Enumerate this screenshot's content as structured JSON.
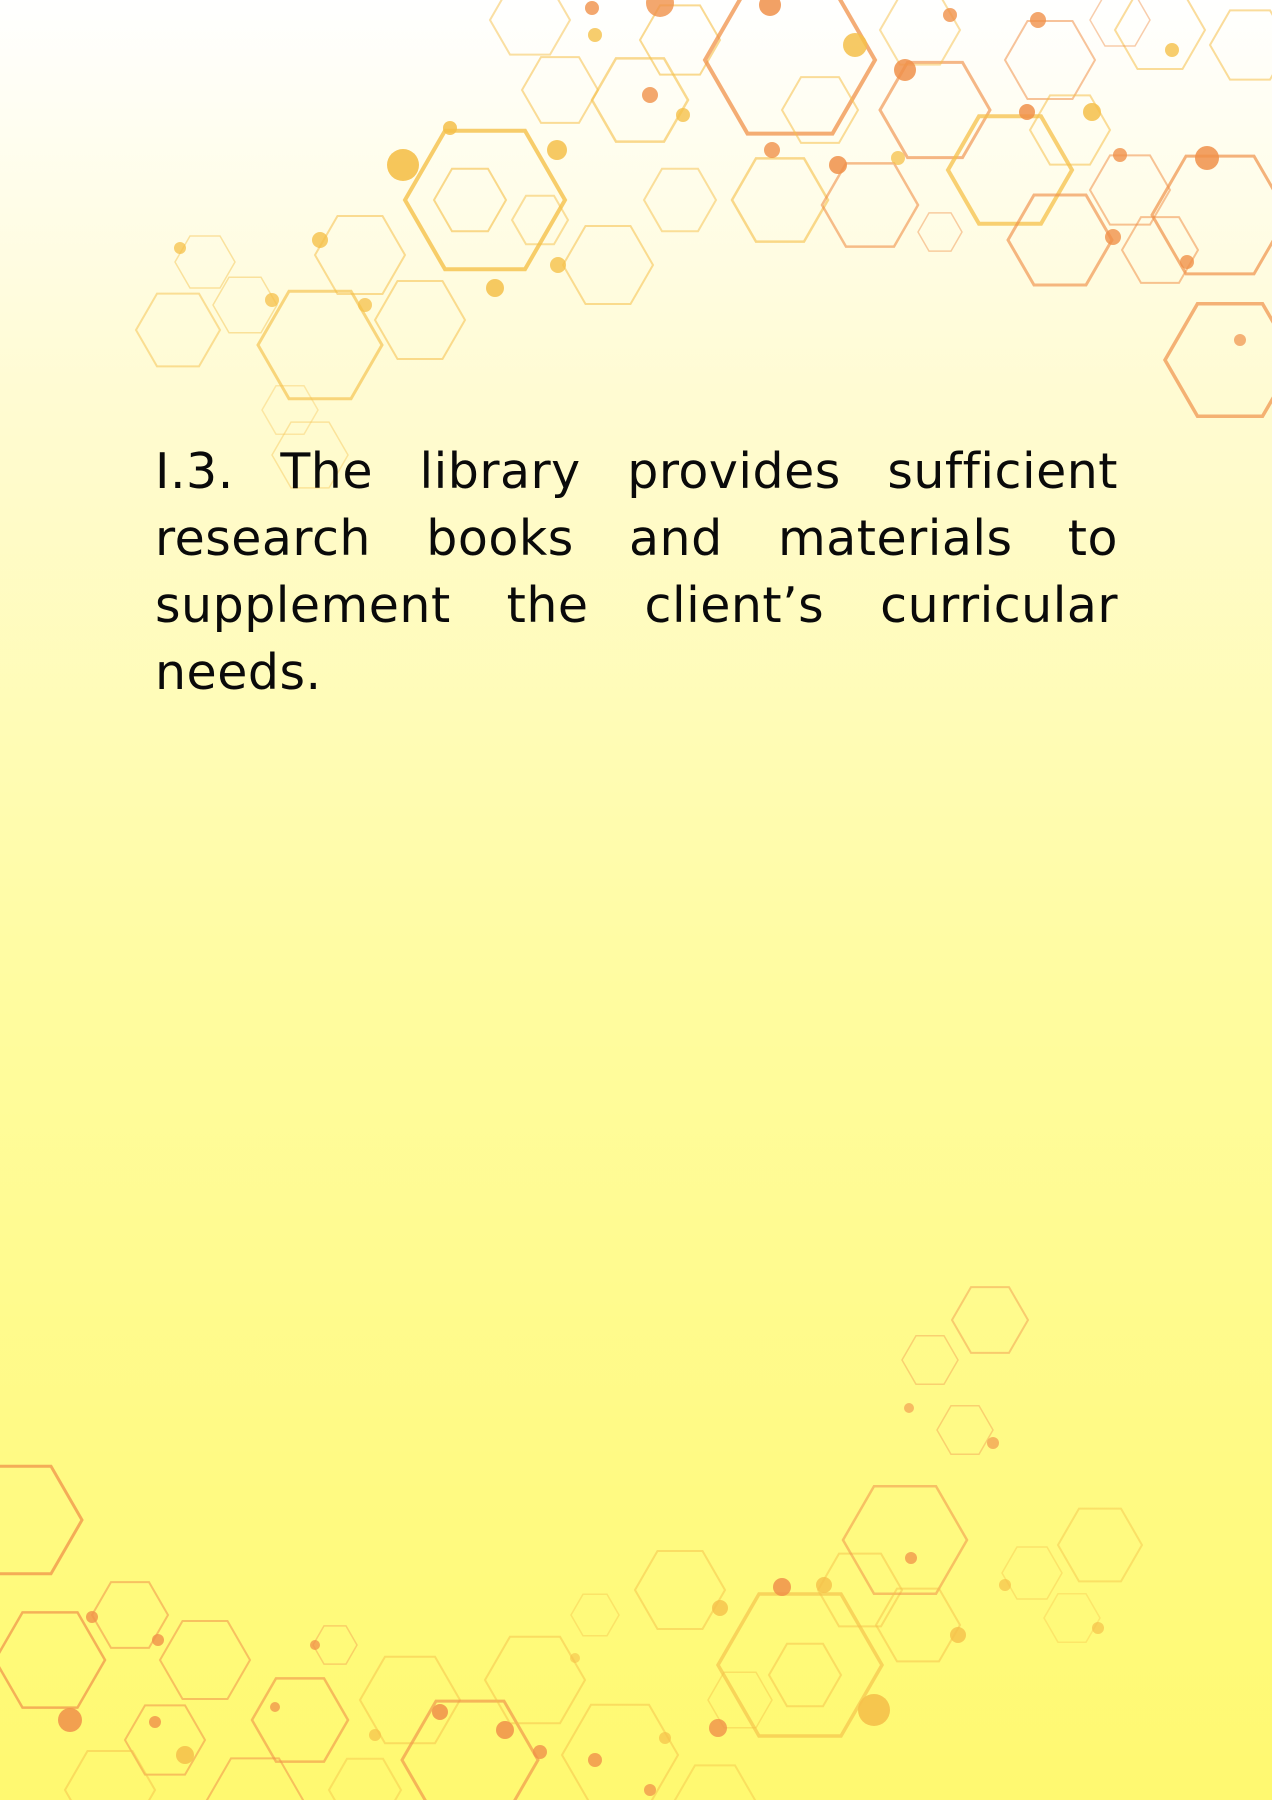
{
  "page": {
    "statement": "I.3. The library provides sufficient research books and materials to supplement the client’s curricular needs."
  },
  "colors": {
    "background_top": "#ffffff",
    "background_bottom": "#fff970",
    "hex_gold": "#f5c04a",
    "hex_orange": "#f0914a",
    "text": "#0a0a0a"
  },
  "decoration": {
    "pattern": "hexagon-molecule-network",
    "placement": [
      "top-right",
      "bottom"
    ]
  }
}
